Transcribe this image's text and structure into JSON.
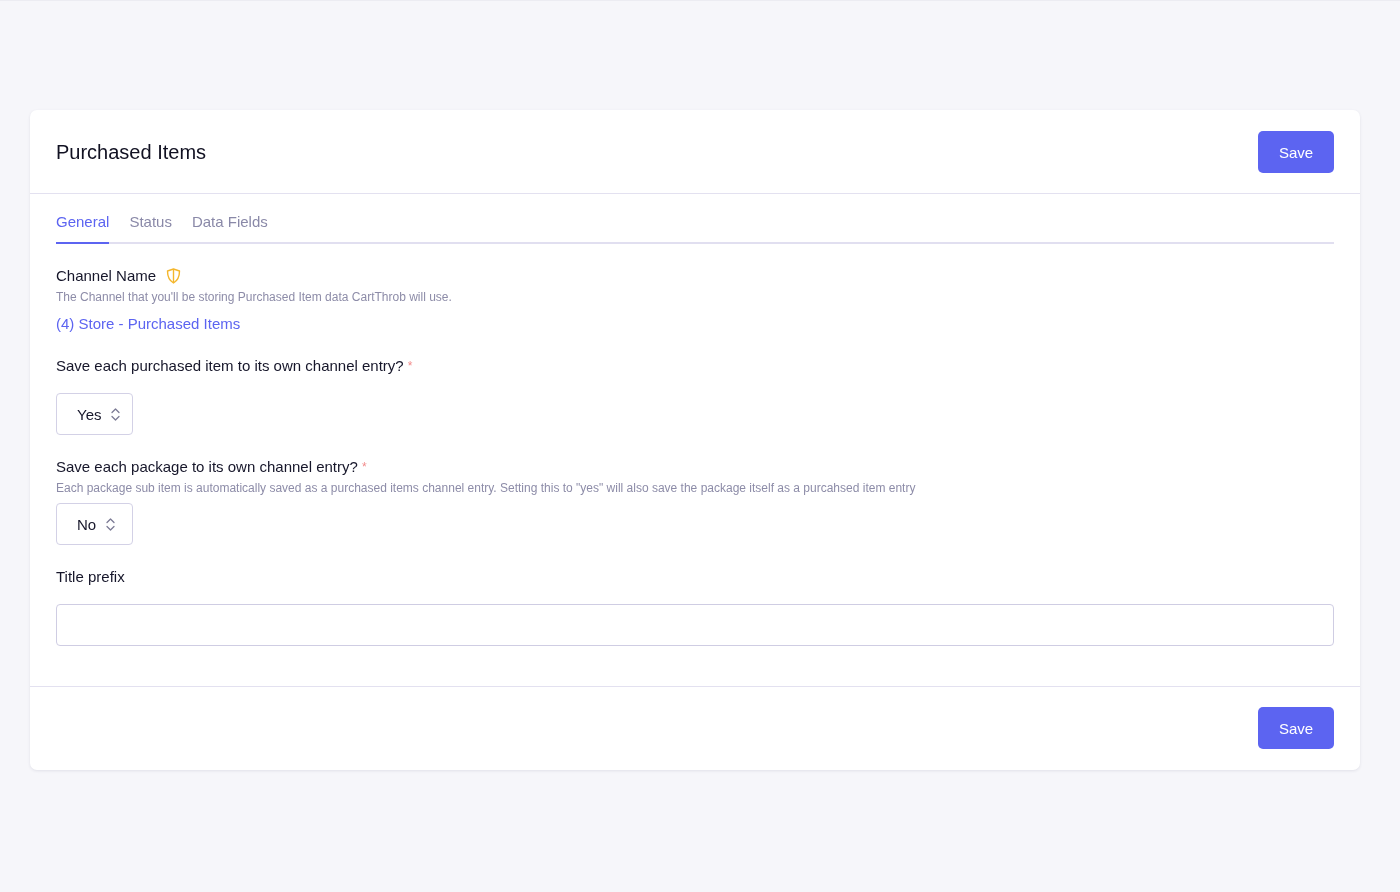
{
  "header": {
    "title": "Purchased Items",
    "save_button": "Save"
  },
  "tabs": [
    {
      "label": "General",
      "selected": true
    },
    {
      "label": "Status",
      "selected": false
    },
    {
      "label": "Data Fields",
      "selected": false
    }
  ],
  "fields": [
    {
      "kind": "channel",
      "label": "Channel Name",
      "hint": "The Channel that you'll be storing Purchased Item data CartThrob will use.",
      "value": "(4) Store - Purchased Items"
    },
    {
      "kind": "select",
      "label": "Save each purchased item to its own channel entry?",
      "required_mark": "*",
      "value": "Yes"
    },
    {
      "kind": "select",
      "label": "Save each package to its own channel entry?",
      "required_mark": "*",
      "hint": "Each package sub item is automatically saved as a purchased items channel entry. Setting this to \"yes\" will also save the package itself as a purcahsed item entry",
      "value": "No"
    },
    {
      "kind": "text",
      "label": "Title prefix"
    }
  ],
  "footer": {
    "save_button": "Save"
  }
}
